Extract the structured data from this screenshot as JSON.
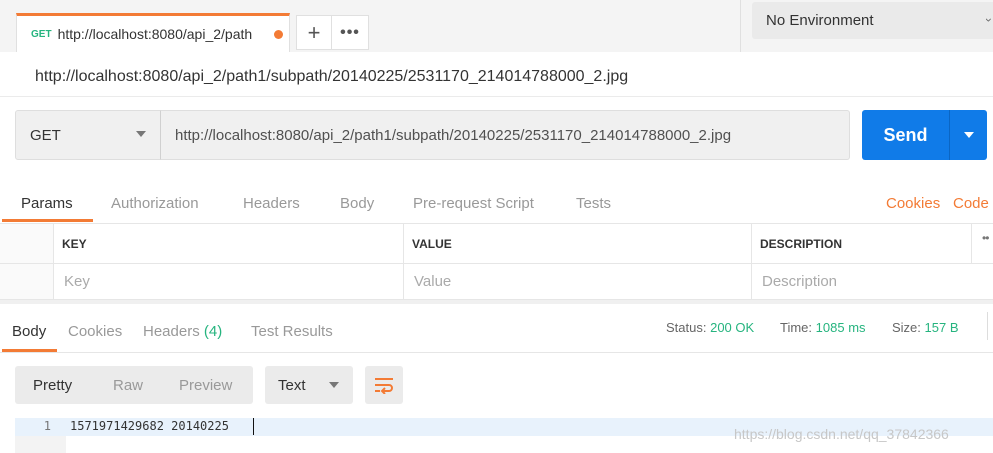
{
  "tab": {
    "method": "GET",
    "title": "http://localhost:8080/api_2/path"
  },
  "icons": {
    "plus": "+",
    "more": "•••",
    "env_chevron": "›"
  },
  "environment": {
    "selected": "No Environment"
  },
  "request": {
    "name": "http://localhost:8080/api_2/path1/subpath/20140225/2531170_214014788000_2.jpg",
    "method": "GET",
    "url": "http://localhost:8080/api_2/path1/subpath/20140225/2531170_214014788000_2.jpg",
    "send_label": "Send"
  },
  "request_tabs": {
    "items": [
      "Params",
      "Authorization",
      "Headers",
      "Body",
      "Pre-request Script",
      "Tests"
    ],
    "cookies": "Cookies",
    "code": "Code"
  },
  "params_table": {
    "headers": [
      "KEY",
      "VALUE",
      "DESCRIPTION"
    ],
    "placeholders": [
      "Key",
      "Value",
      "Description"
    ],
    "more": "••"
  },
  "response": {
    "tabs": {
      "body": "Body",
      "cookies": "Cookies",
      "headers": "Headers",
      "headers_count": "(4)",
      "tests": "Test Results"
    },
    "status": {
      "status_label": "Status:",
      "status_value": "200 OK",
      "time_label": "Time:",
      "time_value": "1085 ms",
      "size_label": "Size:",
      "size_value": "157 B"
    },
    "view_modes": [
      "Pretty",
      "Raw",
      "Preview"
    ],
    "format": "Text",
    "lines": [
      {
        "num": "1",
        "text": "1571971429682 20140225"
      }
    ]
  },
  "watermark": "https://blog.csdn.net/qq_37842366",
  "colors": {
    "accent": "#f37b35",
    "send": "#107be8",
    "success": "#26b47f"
  }
}
